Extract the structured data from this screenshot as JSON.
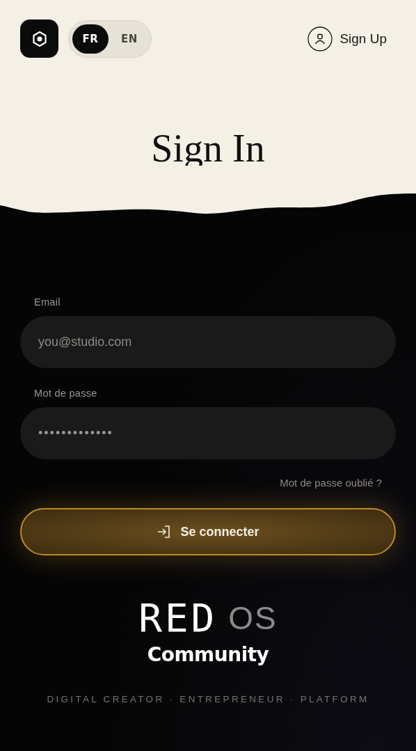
{
  "header": {
    "languages": [
      {
        "label": "FR",
        "selected": true
      },
      {
        "label": "EN",
        "selected": false
      }
    ],
    "signup": "Sign Up"
  },
  "title": "Sign In",
  "form": {
    "fields": [
      {
        "label": "Email",
        "placeholder": "you@studio.com"
      },
      {
        "label": "Mot de passe",
        "value": "•••••••••••••"
      }
    ],
    "forgot": "Mot de passe oublié ?",
    "submit": "Se connecter"
  },
  "brand": {
    "mark": "RED",
    "suffix": "OS",
    "subtitle": "Community",
    "tagline": "DIGITAL CREATOR · ENTREPRENEUR · PLATFORM"
  }
}
